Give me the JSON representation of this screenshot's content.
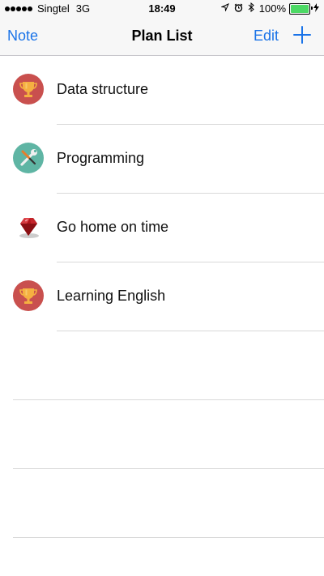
{
  "status_bar": {
    "carrier": "Singtel",
    "network": "3G",
    "time": "18:49",
    "battery": "100%",
    "battery_color": "#4cd964"
  },
  "nav": {
    "left_label": "Note",
    "title": "Plan List",
    "edit_label": "Edit",
    "add_icon": "plus-icon",
    "accent": "#1a73e8"
  },
  "plans": [
    {
      "label": "Data structure",
      "icon": "trophy-icon"
    },
    {
      "label": "Programming",
      "icon": "tools-icon"
    },
    {
      "label": "Go home on time",
      "icon": "ruby-gem-icon"
    },
    {
      "label": "Learning English",
      "icon": "trophy-icon"
    }
  ]
}
